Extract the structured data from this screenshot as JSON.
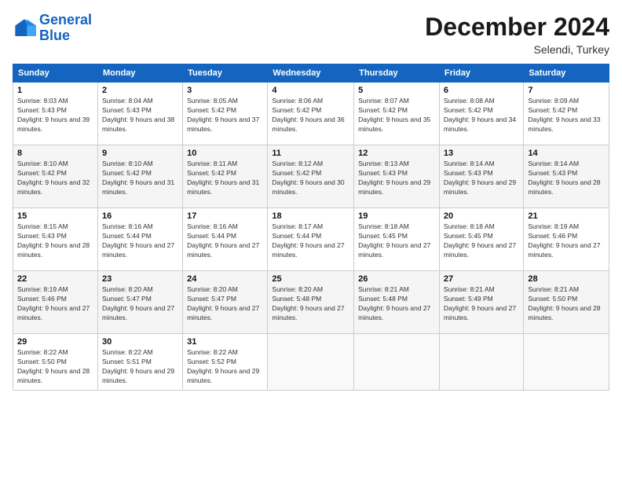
{
  "logo": {
    "line1": "General",
    "line2": "Blue"
  },
  "title": "December 2024",
  "location": "Selendi, Turkey",
  "days_header": [
    "Sunday",
    "Monday",
    "Tuesday",
    "Wednesday",
    "Thursday",
    "Friday",
    "Saturday"
  ],
  "weeks": [
    [
      {
        "day": "1",
        "sunrise": "8:03 AM",
        "sunset": "5:43 PM",
        "daylight": "9 hours and 39 minutes."
      },
      {
        "day": "2",
        "sunrise": "8:04 AM",
        "sunset": "5:43 PM",
        "daylight": "9 hours and 38 minutes."
      },
      {
        "day": "3",
        "sunrise": "8:05 AM",
        "sunset": "5:42 PM",
        "daylight": "9 hours and 37 minutes."
      },
      {
        "day": "4",
        "sunrise": "8:06 AM",
        "sunset": "5:42 PM",
        "daylight": "9 hours and 36 minutes."
      },
      {
        "day": "5",
        "sunrise": "8:07 AM",
        "sunset": "5:42 PM",
        "daylight": "9 hours and 35 minutes."
      },
      {
        "day": "6",
        "sunrise": "8:08 AM",
        "sunset": "5:42 PM",
        "daylight": "9 hours and 34 minutes."
      },
      {
        "day": "7",
        "sunrise": "8:09 AM",
        "sunset": "5:42 PM",
        "daylight": "9 hours and 33 minutes."
      }
    ],
    [
      {
        "day": "8",
        "sunrise": "8:10 AM",
        "sunset": "5:42 PM",
        "daylight": "9 hours and 32 minutes."
      },
      {
        "day": "9",
        "sunrise": "8:10 AM",
        "sunset": "5:42 PM",
        "daylight": "9 hours and 31 minutes."
      },
      {
        "day": "10",
        "sunrise": "8:11 AM",
        "sunset": "5:42 PM",
        "daylight": "9 hours and 31 minutes."
      },
      {
        "day": "11",
        "sunrise": "8:12 AM",
        "sunset": "5:42 PM",
        "daylight": "9 hours and 30 minutes."
      },
      {
        "day": "12",
        "sunrise": "8:13 AM",
        "sunset": "5:43 PM",
        "daylight": "9 hours and 29 minutes."
      },
      {
        "day": "13",
        "sunrise": "8:14 AM",
        "sunset": "5:43 PM",
        "daylight": "9 hours and 29 minutes."
      },
      {
        "day": "14",
        "sunrise": "8:14 AM",
        "sunset": "5:43 PM",
        "daylight": "9 hours and 28 minutes."
      }
    ],
    [
      {
        "day": "15",
        "sunrise": "8:15 AM",
        "sunset": "5:43 PM",
        "daylight": "9 hours and 28 minutes."
      },
      {
        "day": "16",
        "sunrise": "8:16 AM",
        "sunset": "5:44 PM",
        "daylight": "9 hours and 27 minutes."
      },
      {
        "day": "17",
        "sunrise": "8:16 AM",
        "sunset": "5:44 PM",
        "daylight": "9 hours and 27 minutes."
      },
      {
        "day": "18",
        "sunrise": "8:17 AM",
        "sunset": "5:44 PM",
        "daylight": "9 hours and 27 minutes."
      },
      {
        "day": "19",
        "sunrise": "8:18 AM",
        "sunset": "5:45 PM",
        "daylight": "9 hours and 27 minutes."
      },
      {
        "day": "20",
        "sunrise": "8:18 AM",
        "sunset": "5:45 PM",
        "daylight": "9 hours and 27 minutes."
      },
      {
        "day": "21",
        "sunrise": "8:19 AM",
        "sunset": "5:46 PM",
        "daylight": "9 hours and 27 minutes."
      }
    ],
    [
      {
        "day": "22",
        "sunrise": "8:19 AM",
        "sunset": "5:46 PM",
        "daylight": "9 hours and 27 minutes."
      },
      {
        "day": "23",
        "sunrise": "8:20 AM",
        "sunset": "5:47 PM",
        "daylight": "9 hours and 27 minutes."
      },
      {
        "day": "24",
        "sunrise": "8:20 AM",
        "sunset": "5:47 PM",
        "daylight": "9 hours and 27 minutes."
      },
      {
        "day": "25",
        "sunrise": "8:20 AM",
        "sunset": "5:48 PM",
        "daylight": "9 hours and 27 minutes."
      },
      {
        "day": "26",
        "sunrise": "8:21 AM",
        "sunset": "5:48 PM",
        "daylight": "9 hours and 27 minutes."
      },
      {
        "day": "27",
        "sunrise": "8:21 AM",
        "sunset": "5:49 PM",
        "daylight": "9 hours and 27 minutes."
      },
      {
        "day": "28",
        "sunrise": "8:21 AM",
        "sunset": "5:50 PM",
        "daylight": "9 hours and 28 minutes."
      }
    ],
    [
      {
        "day": "29",
        "sunrise": "8:22 AM",
        "sunset": "5:50 PM",
        "daylight": "9 hours and 28 minutes."
      },
      {
        "day": "30",
        "sunrise": "8:22 AM",
        "sunset": "5:51 PM",
        "daylight": "9 hours and 29 minutes."
      },
      {
        "day": "31",
        "sunrise": "8:22 AM",
        "sunset": "5:52 PM",
        "daylight": "9 hours and 29 minutes."
      },
      null,
      null,
      null,
      null
    ]
  ],
  "labels": {
    "sunrise": "Sunrise: ",
    "sunset": "Sunset: ",
    "daylight": "Daylight: "
  }
}
